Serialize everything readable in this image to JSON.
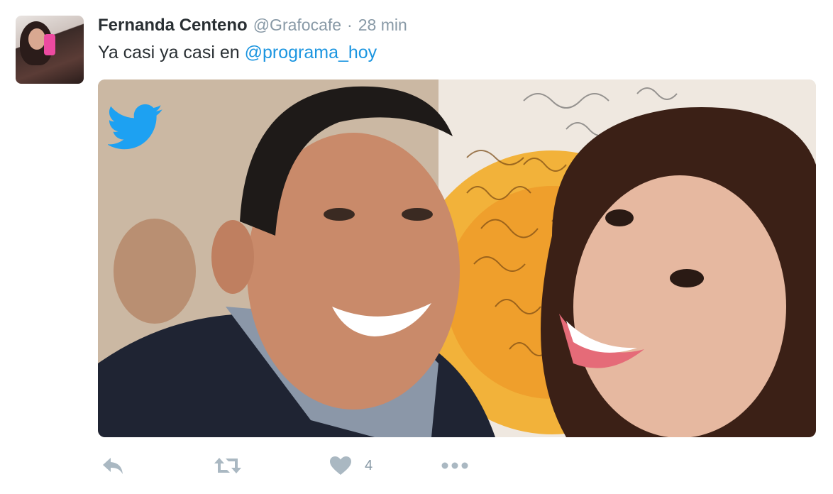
{
  "tweet": {
    "author_name": "Fernanda Centeno",
    "author_handle": "@Grafocafe",
    "separator": "·",
    "timestamp": "28 min",
    "text_prefix": "Ya casi ya casi en ",
    "mention": "@programa_hoy"
  },
  "media": {
    "overlay_icon": "twitter-bird-icon",
    "brand_color": "#1da1f2"
  },
  "actions": {
    "reply_icon": "reply-icon",
    "retweet_icon": "retweet-icon",
    "like_icon": "heart-icon",
    "like_count": "4",
    "more_icon": "more-dots-icon",
    "icon_color": "#aab8c2"
  },
  "colors": {
    "name": "#292f33",
    "meta": "#8899a6",
    "link": "#1b95e0"
  }
}
